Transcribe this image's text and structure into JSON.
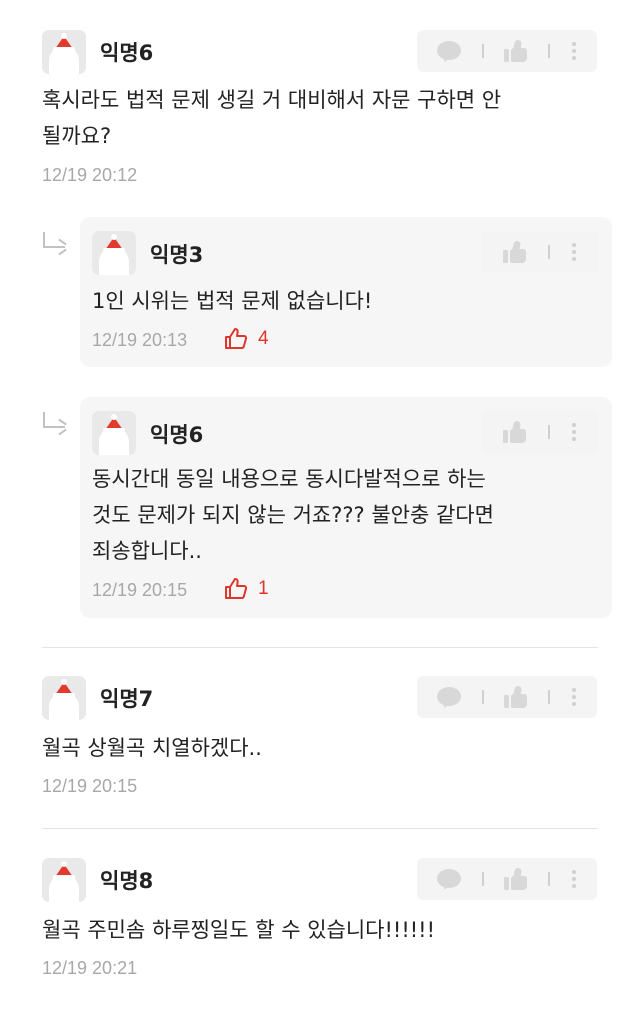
{
  "comments": [
    {
      "nickname": "익명6",
      "text": "혹시라도 법적 문제 생길 거 대비해서 자문 구하면 안\n될까요?",
      "time": "12/19 20:12"
    },
    {
      "nickname": "익명7",
      "text": "월곡 상월곡 치열하겠다..",
      "time": "12/19 20:15"
    },
    {
      "nickname": "익명8",
      "text": "월곡 주민솜 하루찡일도 할 수 있습니다!!!!!!",
      "time": "12/19 20:21"
    }
  ],
  "replies": [
    {
      "nickname": "익명3",
      "text": "1인 시위는 법적 문제 없습니다!",
      "time": "12/19 20:13",
      "likes": "4"
    },
    {
      "nickname": "익명6",
      "text": "동시간대 동일 내용으로 동시다발적으로 하는\n것도 문제가 되지 않는 거죠??? 불안충 같다면\n죄송합니다..",
      "time": "12/19 20:15",
      "likes": "1"
    }
  ],
  "icons": {
    "comment": "speech-bubble-icon",
    "like": "thumbs-up-icon",
    "more": "more-vertical-icon",
    "reply": "reply-arrow-icon",
    "like_count": "thumbs-up-outline-icon"
  },
  "colors": {
    "like_accent": "#e0352b",
    "reply_background": "#f6f6f6",
    "timestamp": "#a8a8a8"
  }
}
